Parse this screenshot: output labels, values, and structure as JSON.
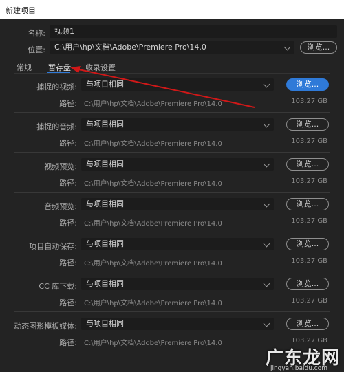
{
  "window": {
    "title": "新建项目"
  },
  "project": {
    "name_label": "名称:",
    "name_value": "视频1",
    "location_label": "位置:",
    "location_value": "C:\\用户\\hp\\文档\\Adobe\\Premiere Pro\\14.0",
    "browse": "浏览..."
  },
  "tabs": [
    {
      "label": "常规"
    },
    {
      "label": "暂存盘"
    },
    {
      "label": "收录设置"
    }
  ],
  "active_tab": "暂存盘",
  "scratch": {
    "path_label": "路径:",
    "items": [
      {
        "label": "捕捉的视频:",
        "select": "与项目相同",
        "browse": "浏览...",
        "path": "C:\\用户\\hp\\文档\\Adobe\\Premiere Pro\\14.0",
        "size": "103.27 GB"
      },
      {
        "label": "捕捉的音频:",
        "select": "与项目相同",
        "browse": "浏览...",
        "path": "C:\\用户\\hp\\文档\\Adobe\\Premiere Pro\\14.0",
        "size": "103.27 GB"
      },
      {
        "label": "视频预览:",
        "select": "与项目相同",
        "browse": "浏览...",
        "path": "C:\\用户\\hp\\文档\\Adobe\\Premiere Pro\\14.0",
        "size": "103.27 GB"
      },
      {
        "label": "音频预览:",
        "select": "与项目相同",
        "browse": "浏览...",
        "path": "C:\\用户\\hp\\文档\\Adobe\\Premiere Pro\\14.0",
        "size": "103.27 GB"
      },
      {
        "label": "项目自动保存:",
        "select": "与项目相同",
        "browse": "浏览...",
        "path": "C:\\用户\\hp\\文档\\Adobe\\Premiere Pro\\14.0",
        "size": "103.27 GB"
      },
      {
        "label": "CC 库下载:",
        "select": "与项目相同",
        "browse": "浏览...",
        "path": "C:\\用户\\hp\\文档\\Adobe\\Premiere Pro\\14.0",
        "size": "103.27 GB"
      },
      {
        "label": "动态图形模板媒体:",
        "select": "与项目相同",
        "browse": "浏览...",
        "path": "C:\\用户\\hp\\文档\\Adobe\\Premiere Pro\\14.0",
        "size": "103.27 GB"
      }
    ]
  },
  "watermark": {
    "text": "广东龙网",
    "sub": "jingyan.baidu.com"
  },
  "colors": {
    "accent": "#2f7ad8",
    "annotation_arrow": "#d01818",
    "background": "#232323"
  }
}
